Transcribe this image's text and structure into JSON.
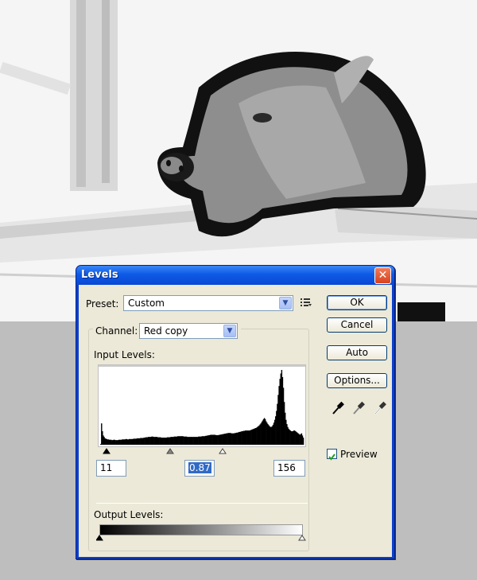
{
  "dialog": {
    "title": "Levels"
  },
  "preset": {
    "label": "Preset:",
    "value": "Custom"
  },
  "channel": {
    "label": "Channel:",
    "value": "Red copy"
  },
  "input_levels": {
    "label": "Input Levels:",
    "black": "11",
    "gamma": "0.87",
    "white": "156"
  },
  "output_levels": {
    "label": "Output Levels:",
    "black": "0",
    "white": "255"
  },
  "buttons": {
    "ok": "OK",
    "cancel": "Cancel",
    "auto": "Auto",
    "options": "Options..."
  },
  "preview": {
    "label": "Preview",
    "checked": true
  },
  "icons": {
    "close": "close-icon",
    "preset_menu": "preset-options-icon",
    "black_eyedropper": "black-eyedropper-icon",
    "gray_eyedropper": "gray-eyedropper-icon",
    "white_eyedropper": "white-eyedropper-icon"
  },
  "chart_data": {
    "type": "area",
    "title": "",
    "xlim": [
      0,
      255
    ],
    "histogram": [
      2,
      60,
      38,
      26,
      22,
      18,
      17,
      16,
      15,
      15,
      14,
      14,
      14,
      13,
      13,
      14,
      14,
      13,
      13,
      13,
      13,
      14,
      14,
      14,
      14,
      15,
      15,
      15,
      15,
      16,
      16,
      15,
      15,
      16,
      16,
      16,
      16,
      16,
      17,
      17,
      17,
      17,
      18,
      18,
      18,
      18,
      19,
      19,
      19,
      19,
      20,
      20,
      21,
      21,
      21,
      22,
      22,
      22,
      22,
      23,
      23,
      22,
      22,
      22,
      22,
      22,
      21,
      21,
      21,
      21,
      20,
      20,
      20,
      20,
      20,
      20,
      20,
      21,
      21,
      21,
      21,
      22,
      22,
      22,
      22,
      23,
      23,
      23,
      23,
      24,
      24,
      24,
      24,
      24,
      24,
      24,
      23,
      23,
      23,
      23,
      22,
      22,
      22,
      22,
      22,
      22,
      22,
      22,
      22,
      22,
      22,
      22,
      22,
      23,
      23,
      23,
      23,
      24,
      24,
      24,
      24,
      25,
      25,
      26,
      26,
      27,
      27,
      28,
      28,
      28,
      28,
      28,
      28,
      27,
      27,
      27,
      27,
      28,
      28,
      29,
      29,
      30,
      30,
      31,
      31,
      32,
      32,
      33,
      33,
      33,
      33,
      32,
      32,
      32,
      32,
      33,
      33,
      34,
      34,
      35,
      36,
      36,
      37,
      38,
      38,
      39,
      39,
      40,
      40,
      40,
      40,
      40,
      40,
      41,
      42,
      43,
      44,
      45,
      46,
      47,
      48,
      50,
      52,
      54,
      57,
      60,
      64,
      68,
      72,
      75,
      72,
      66,
      62,
      58,
      55,
      52,
      50,
      50,
      52,
      56,
      62,
      70,
      80,
      95,
      115,
      140,
      165,
      185,
      200,
      210,
      190,
      160,
      120,
      90,
      70,
      58,
      50,
      45,
      42,
      40,
      38,
      38,
      38,
      40,
      40,
      38,
      36,
      34,
      32,
      30,
      28,
      30,
      32,
      26,
      20
    ]
  }
}
